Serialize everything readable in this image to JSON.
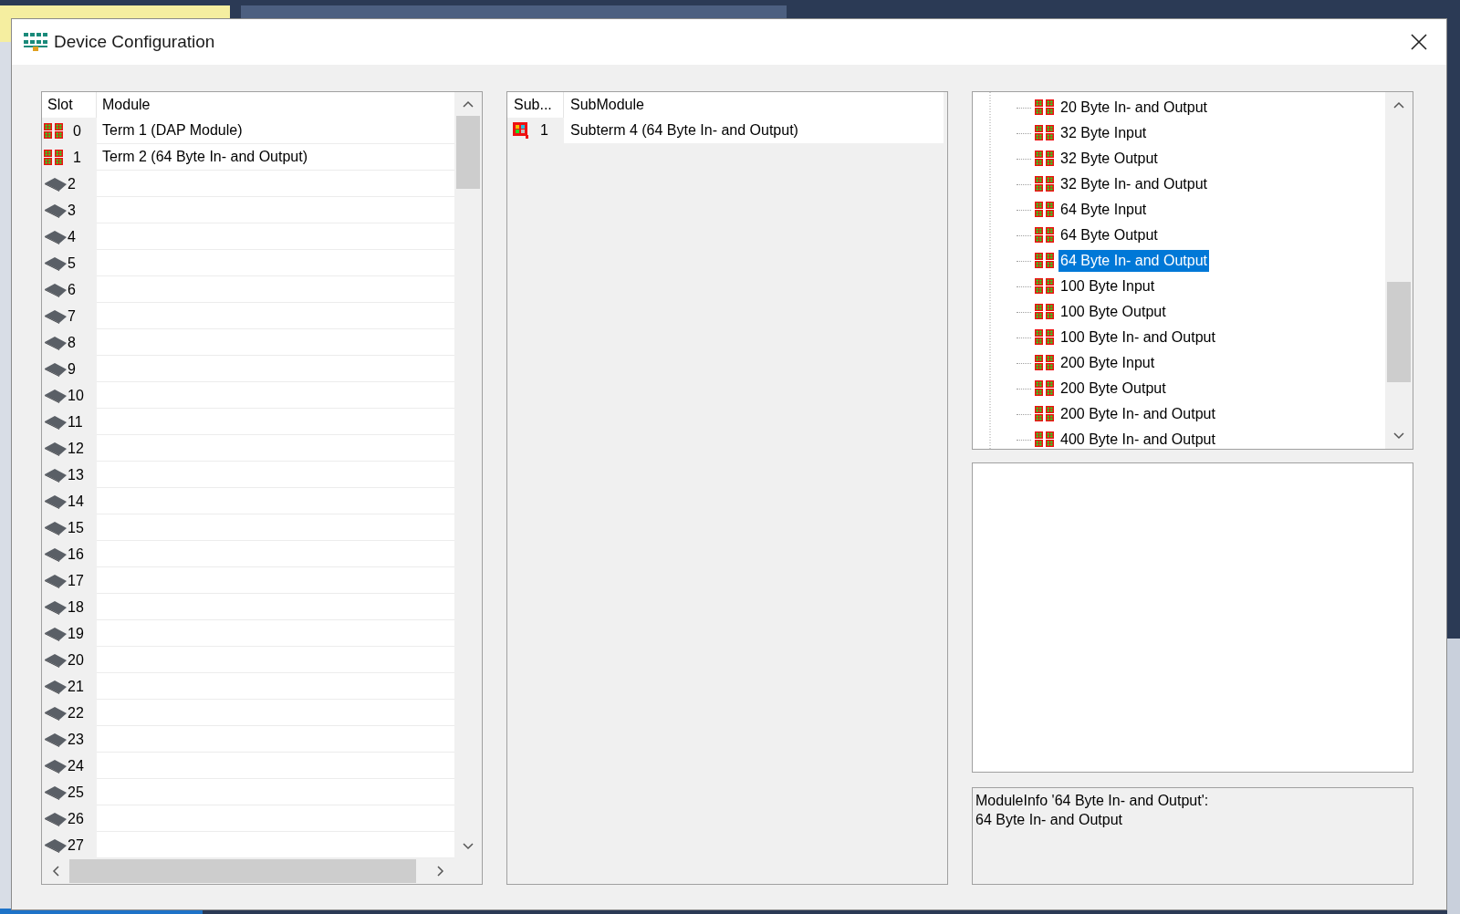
{
  "window": {
    "title": "Device Configuration"
  },
  "slots_table": {
    "columns": [
      "Slot",
      "Module"
    ],
    "rows": [
      {
        "slot": "0",
        "module": "Term 1 (DAP Module)",
        "kind": "module"
      },
      {
        "slot": "1",
        "module": "Term 2 (64 Byte In- and Output)",
        "kind": "module"
      },
      {
        "slot": "2",
        "kind": "empty"
      },
      {
        "slot": "3",
        "kind": "empty"
      },
      {
        "slot": "4",
        "kind": "empty"
      },
      {
        "slot": "5",
        "kind": "empty"
      },
      {
        "slot": "6",
        "kind": "empty"
      },
      {
        "slot": "7",
        "kind": "empty"
      },
      {
        "slot": "8",
        "kind": "empty"
      },
      {
        "slot": "9",
        "kind": "empty"
      },
      {
        "slot": "10",
        "kind": "empty"
      },
      {
        "slot": "11",
        "kind": "empty"
      },
      {
        "slot": "12",
        "kind": "empty"
      },
      {
        "slot": "13",
        "kind": "empty"
      },
      {
        "slot": "14",
        "kind": "empty"
      },
      {
        "slot": "15",
        "kind": "empty"
      },
      {
        "slot": "16",
        "kind": "empty"
      },
      {
        "slot": "17",
        "kind": "empty"
      },
      {
        "slot": "18",
        "kind": "empty"
      },
      {
        "slot": "19",
        "kind": "empty"
      },
      {
        "slot": "20",
        "kind": "empty"
      },
      {
        "slot": "21",
        "kind": "empty"
      },
      {
        "slot": "22",
        "kind": "empty"
      },
      {
        "slot": "23",
        "kind": "empty"
      },
      {
        "slot": "24",
        "kind": "empty"
      },
      {
        "slot": "25",
        "kind": "empty"
      },
      {
        "slot": "26",
        "kind": "empty"
      },
      {
        "slot": "27",
        "kind": "empty"
      }
    ]
  },
  "submodule_table": {
    "columns": [
      "Sub...",
      "SubModule"
    ],
    "rows": [
      {
        "sub": "1",
        "submodule": "Subterm 4 (64 Byte In- and Output)"
      }
    ]
  },
  "module_tree": {
    "items": [
      {
        "label": "20 Byte In- and Output",
        "selected": false
      },
      {
        "label": "32 Byte Input",
        "selected": false
      },
      {
        "label": "32 Byte Output",
        "selected": false
      },
      {
        "label": "32 Byte In- and Output",
        "selected": false
      },
      {
        "label": "64 Byte Input",
        "selected": false
      },
      {
        "label": "64 Byte Output",
        "selected": false
      },
      {
        "label": "64 Byte In- and Output",
        "selected": true
      },
      {
        "label": "100 Byte Input",
        "selected": false
      },
      {
        "label": "100 Byte Output",
        "selected": false
      },
      {
        "label": "100 Byte In- and Output",
        "selected": false
      },
      {
        "label": "200 Byte Input",
        "selected": false
      },
      {
        "label": "200 Byte Output",
        "selected": false
      },
      {
        "label": "200 Byte In- and Output",
        "selected": false
      },
      {
        "label": "400 Byte In- and Output",
        "selected": false
      }
    ]
  },
  "module_info": {
    "lines": [
      "ModuleInfo '64 Byte In- and Output':",
      "64 Byte In- and Output"
    ]
  }
}
